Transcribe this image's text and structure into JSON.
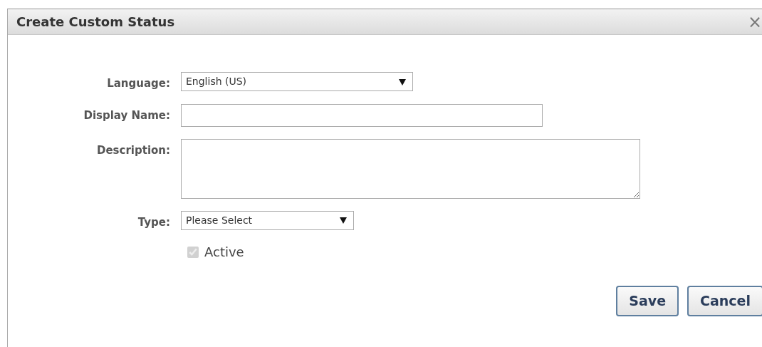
{
  "window": {
    "title": "Create Custom Status",
    "close": "×"
  },
  "fields": [
    {
      "kind": "select",
      "label": "Language:",
      "value": "English (US)"
    },
    {
      "kind": "text",
      "label": "Display Name:"
    },
    {
      "kind": "textarea",
      "label": "Description:"
    },
    {
      "kind": "select",
      "label": "Type:",
      "value": "Please Select"
    }
  ],
  "active": {
    "label": "Active",
    "checked": true,
    "disabled": true
  },
  "buttons": [
    "Save",
    "Cancel"
  ]
}
